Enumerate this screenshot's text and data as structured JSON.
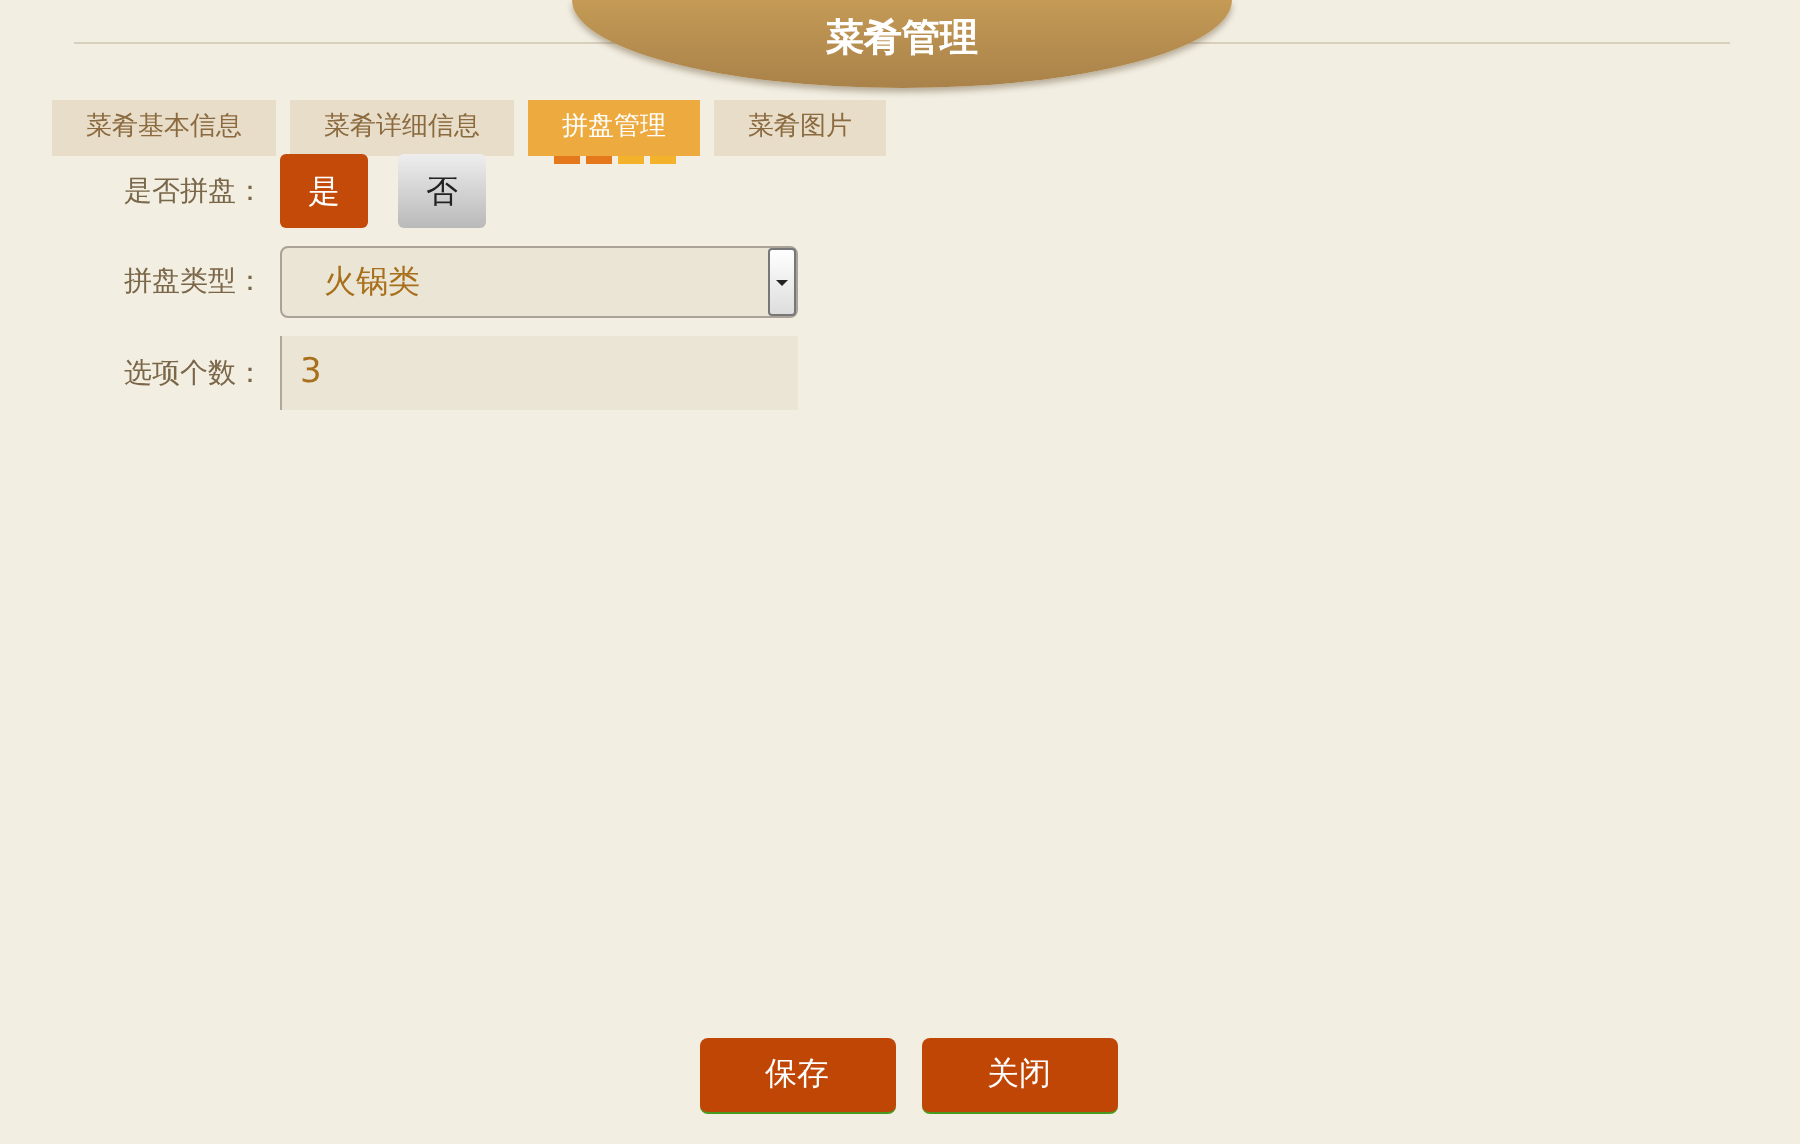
{
  "title": "菜肴管理",
  "tabs": [
    {
      "label": "菜肴基本信息",
      "selected": false
    },
    {
      "label": "菜肴详细信息",
      "selected": false
    },
    {
      "label": "拼盘管理",
      "selected": true
    },
    {
      "label": "菜肴图片",
      "selected": false
    }
  ],
  "form": {
    "is_platter": {
      "label": "是否拼盘：",
      "options": [
        {
          "label": "是",
          "selected": true
        },
        {
          "label": "否",
          "selected": false
        }
      ]
    },
    "platter_type": {
      "label": "拼盘类型：",
      "value": "火锅类"
    },
    "option_count": {
      "label": "选项个数：",
      "value": "3"
    }
  },
  "buttons": [
    "保存",
    "关闭"
  ]
}
